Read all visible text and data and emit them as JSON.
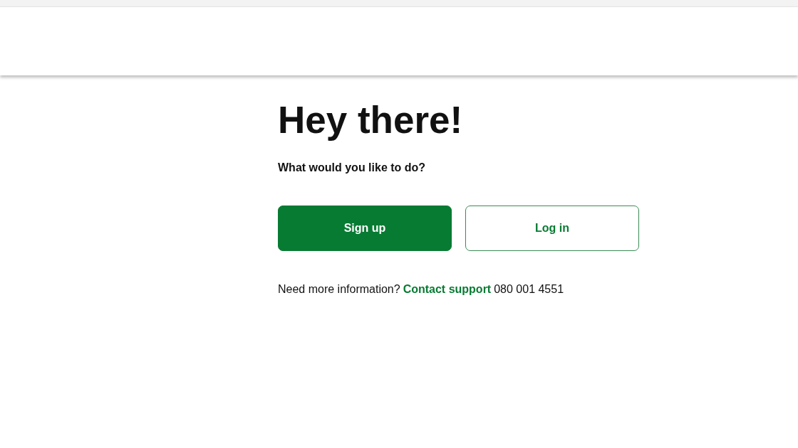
{
  "heading": "Hey there!",
  "prompt": "What would you like to do?",
  "buttons": [
    {
      "label": "Sign up",
      "kind": "primary"
    },
    {
      "label": "Log in",
      "kind": "outline"
    }
  ],
  "help": {
    "text": "Need more information?",
    "link": "Contact support",
    "phone": "080 001 4551"
  }
}
